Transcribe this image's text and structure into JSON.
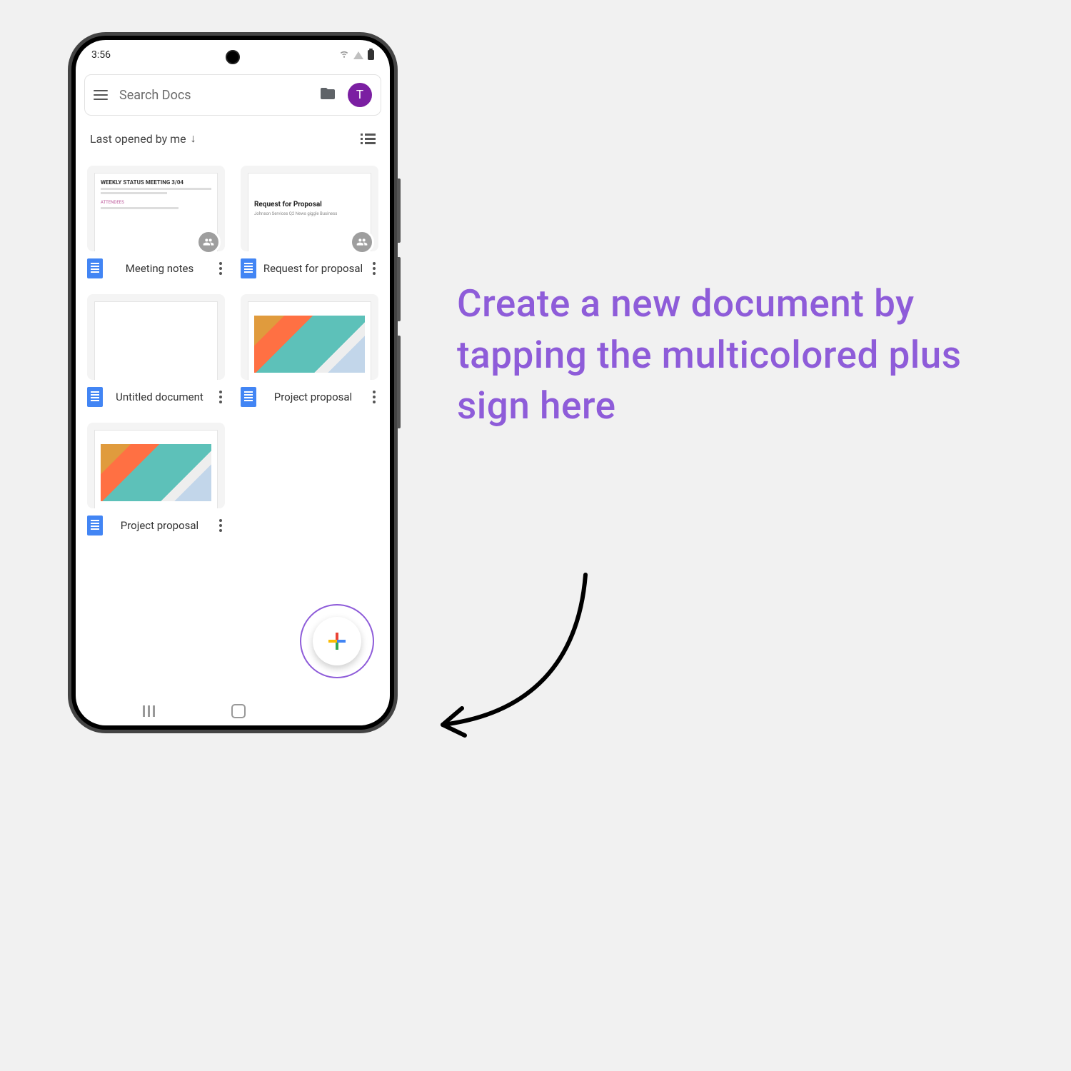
{
  "statusbar": {
    "time": "3:56"
  },
  "search": {
    "placeholder": "Search Docs"
  },
  "avatar": {
    "initial": "T"
  },
  "filter": {
    "label": "Last opened by me"
  },
  "docs": [
    {
      "title": "Meeting notes",
      "thumb": "meeting",
      "shared": true
    },
    {
      "title": "Request for proposal",
      "thumb": "proposal",
      "shared": true
    },
    {
      "title": "Untitled document",
      "thumb": "blank",
      "shared": false
    },
    {
      "title": "Project proposal",
      "thumb": "geo",
      "shared": false
    },
    {
      "title": "Project proposal",
      "thumb": "geo",
      "shared": false
    }
  ],
  "thumb_text": {
    "meeting_header": "WEEKLY STATUS MEETING 3/04",
    "proposal_header": "Request for Proposal",
    "proposal_sub": "Johnson Services Q2 News giggle Business"
  },
  "callout": "Create a new document by tapping the multicolored plus sign here"
}
